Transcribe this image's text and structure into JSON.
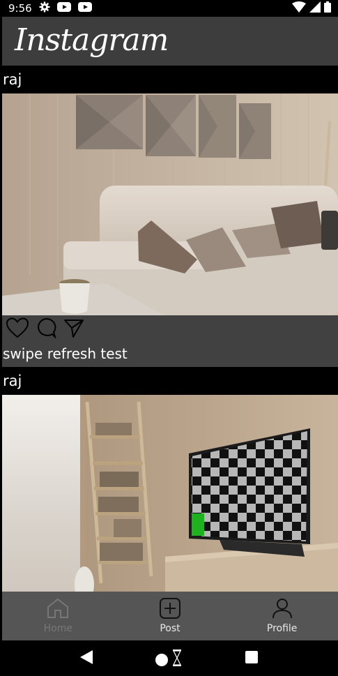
{
  "status_bar": {
    "time": "9:56"
  },
  "app": {
    "logo_text": "Instagram"
  },
  "posts": [
    {
      "username": "raj",
      "caption": "swipe refresh test",
      "image": "living-room-sofa"
    },
    {
      "username": "raj",
      "caption": "",
      "image": "room-with-tv-checkerboard"
    }
  ],
  "bottom_nav": {
    "items": [
      {
        "label": "Home",
        "icon": "home-icon",
        "state": "dim"
      },
      {
        "label": "Post",
        "icon": "add-post-icon",
        "state": "active"
      },
      {
        "label": "Profile",
        "icon": "profile-icon",
        "state": "active"
      }
    ]
  },
  "system_nav": [
    "back-icon",
    "home-circle-icon",
    "recents-icon"
  ]
}
